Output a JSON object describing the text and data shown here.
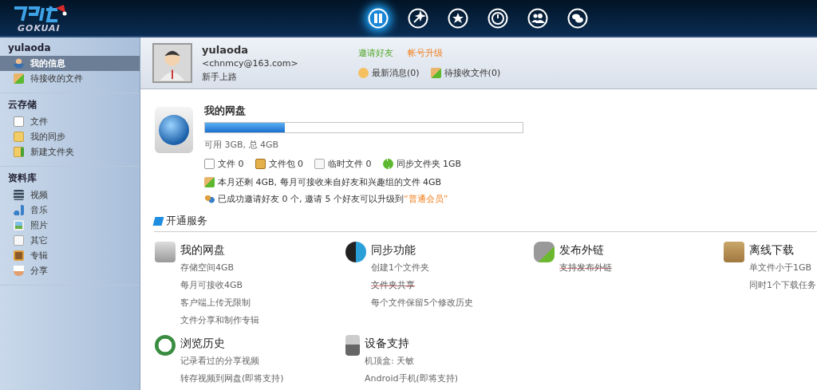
{
  "header": {
    "logo_text": "GOKUAI",
    "nav": [
      {
        "selected": true
      },
      {
        "selected": false
      },
      {
        "selected": false
      },
      {
        "selected": false
      },
      {
        "selected": false
      },
      {
        "selected": false
      }
    ]
  },
  "sidebar": {
    "sections": [
      {
        "title": "yulaoda",
        "items": [
          {
            "label": "我的信息",
            "selected": true
          },
          {
            "label": "待接收的文件",
            "selected": false
          }
        ]
      },
      {
        "title": "云存储",
        "items": [
          {
            "label": "文件",
            "selected": false
          },
          {
            "label": "我的同步",
            "selected": false
          },
          {
            "label": "新建文件夹",
            "selected": false
          }
        ]
      },
      {
        "title": "资料库",
        "items": [
          {
            "label": "视频",
            "selected": false
          },
          {
            "label": "音乐",
            "selected": false
          },
          {
            "label": "照片",
            "selected": false
          },
          {
            "label": "其它",
            "selected": false
          },
          {
            "label": "专辑",
            "selected": false
          },
          {
            "label": "分享",
            "selected": false
          }
        ]
      }
    ]
  },
  "profile": {
    "name": "yulaoda",
    "email": "<chnmcy@163.com>",
    "level": "新手上路",
    "invite_link": "邀请好友",
    "upgrade_link": "帐号升级",
    "messages": "最新消息(0)",
    "pending": "待接收文件(0)"
  },
  "disk": {
    "title": "我的网盘",
    "level": 0.25,
    "usage": "可用 3GB, 总 4GB",
    "stats": [
      "文件 0",
      "文件包 0",
      "临时文件 0",
      "同步文件夹 1GB"
    ],
    "quota": "本月还剩 4GB, 每月可接收来自好友和兴趣组的文件 4GB",
    "invite": "已成功邀请好友 0 个, 邀请 5 个好友可以升级到",
    "invite_level": "“普通会员”"
  },
  "services": {
    "title": "开通服务",
    "items": [
      {
        "title": "我的网盘",
        "lines": [
          {
            "text": "存储空间4GB",
            "disabled": false
          },
          {
            "text": "每月可接收4GB",
            "disabled": false
          },
          {
            "text": "客户端上传无限制",
            "disabled": false
          },
          {
            "text": "文件分享和制作专辑",
            "disabled": false
          }
        ]
      },
      {
        "title": "同步功能",
        "lines": [
          {
            "text": "创建1个文件夹",
            "disabled": false
          },
          {
            "text": "文件夹共享",
            "disabled": true
          },
          {
            "text": "每个文件保留5个修改历史",
            "disabled": false
          }
        ]
      },
      {
        "title": "发布外链",
        "lines": [
          {
            "text": "支持发布外链",
            "disabled": true
          }
        ]
      },
      {
        "title": "离线下载",
        "lines": [
          {
            "text": "单文件小于1GB",
            "disabled": false
          },
          {
            "text": "同时1个下载任务",
            "disabled": false
          }
        ]
      },
      {
        "title": "浏览历史",
        "lines": [
          {
            "text": "记录看过的分享视频",
            "disabled": false
          },
          {
            "text": "转存视频到网盘(即将支持)",
            "disabled": false
          }
        ]
      },
      {
        "title": "设备支持",
        "lines": [
          {
            "text": "机顶盒: 天敏",
            "disabled": false
          },
          {
            "text": "Android手机(即将支持)",
            "disabled": false
          }
        ]
      }
    ]
  }
}
